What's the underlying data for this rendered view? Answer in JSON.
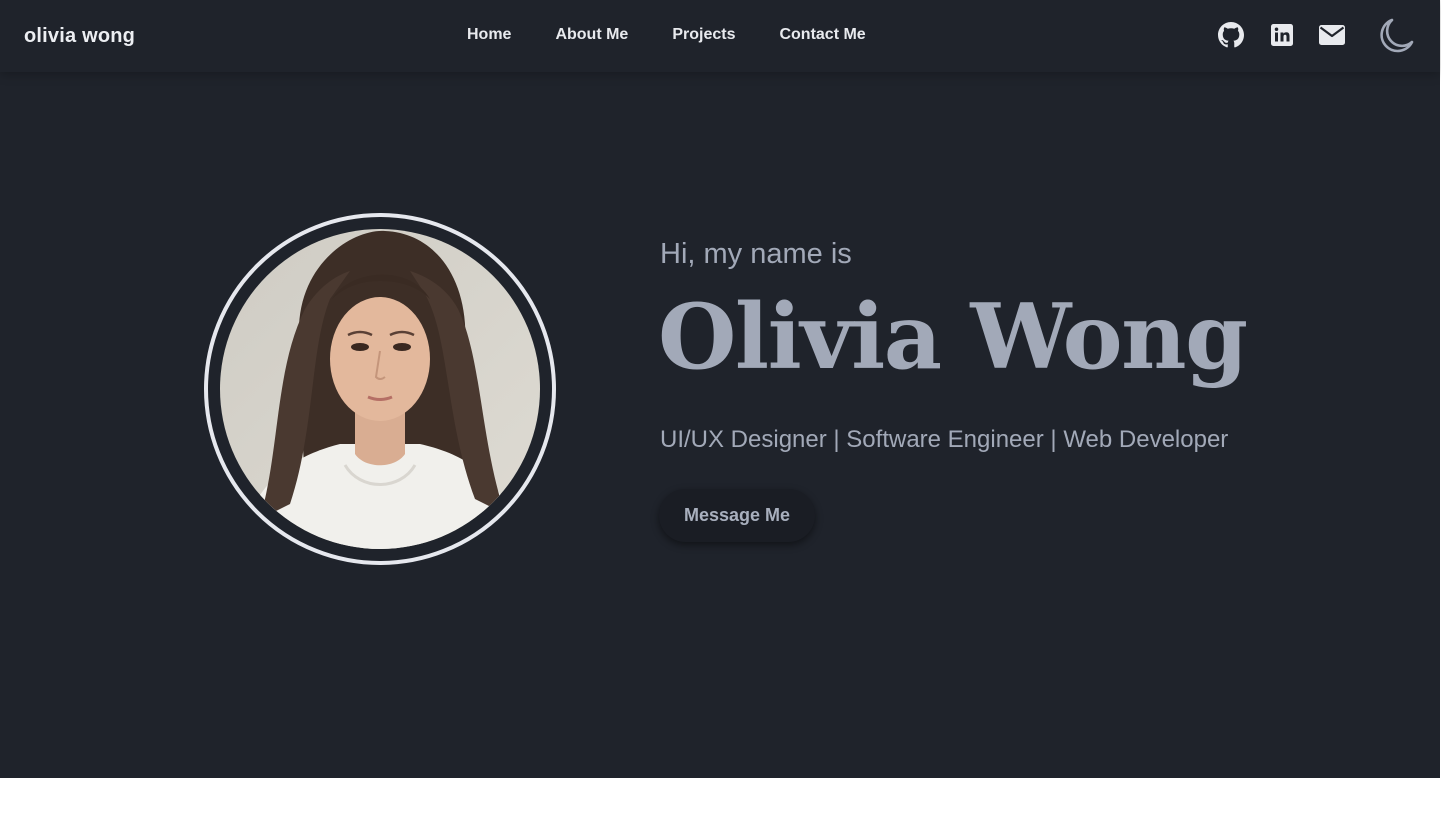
{
  "navbar": {
    "brand": "olivia wong",
    "links": [
      {
        "label": "Home"
      },
      {
        "label": "About Me"
      },
      {
        "label": "Projects"
      },
      {
        "label": "Contact Me"
      }
    ],
    "icons": [
      "github-icon",
      "linkedin-icon",
      "mail-icon",
      "moon-icon"
    ]
  },
  "hero": {
    "intro": "Hi, my name is",
    "name": "Olivia Wong",
    "roles": "UI/UX Designer | Software Engineer | Web Developer",
    "cta_label": "Message Me"
  },
  "colors": {
    "background": "#1f232b",
    "text_muted": "#a2a9b8",
    "nav_text": "#e8eaee",
    "ring": "#e6e8ee",
    "button_bg": "#1a1d24"
  }
}
